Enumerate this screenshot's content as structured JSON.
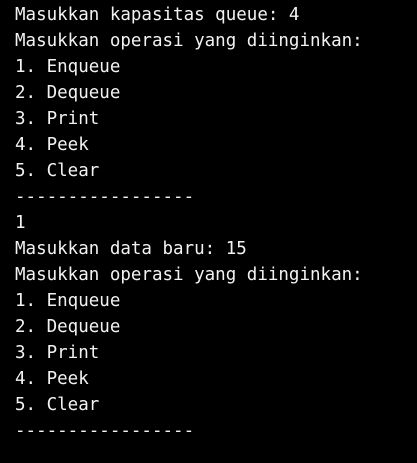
{
  "console": {
    "text_color": "#f2f2f2",
    "background_color": "#000000",
    "lines": [
      "Masukkan kapasitas queue: 4",
      "Masukkan operasi yang diinginkan:",
      "1. Enqueue",
      "2. Dequeue",
      "3. Print",
      "4. Peek",
      "5. Clear",
      "-----------------",
      "1",
      "Masukkan data baru: 15",
      "Masukkan operasi yang diinginkan:",
      "1. Enqueue",
      "2. Dequeue",
      "3. Print",
      "4. Peek",
      "5. Clear",
      "-----------------"
    ]
  }
}
